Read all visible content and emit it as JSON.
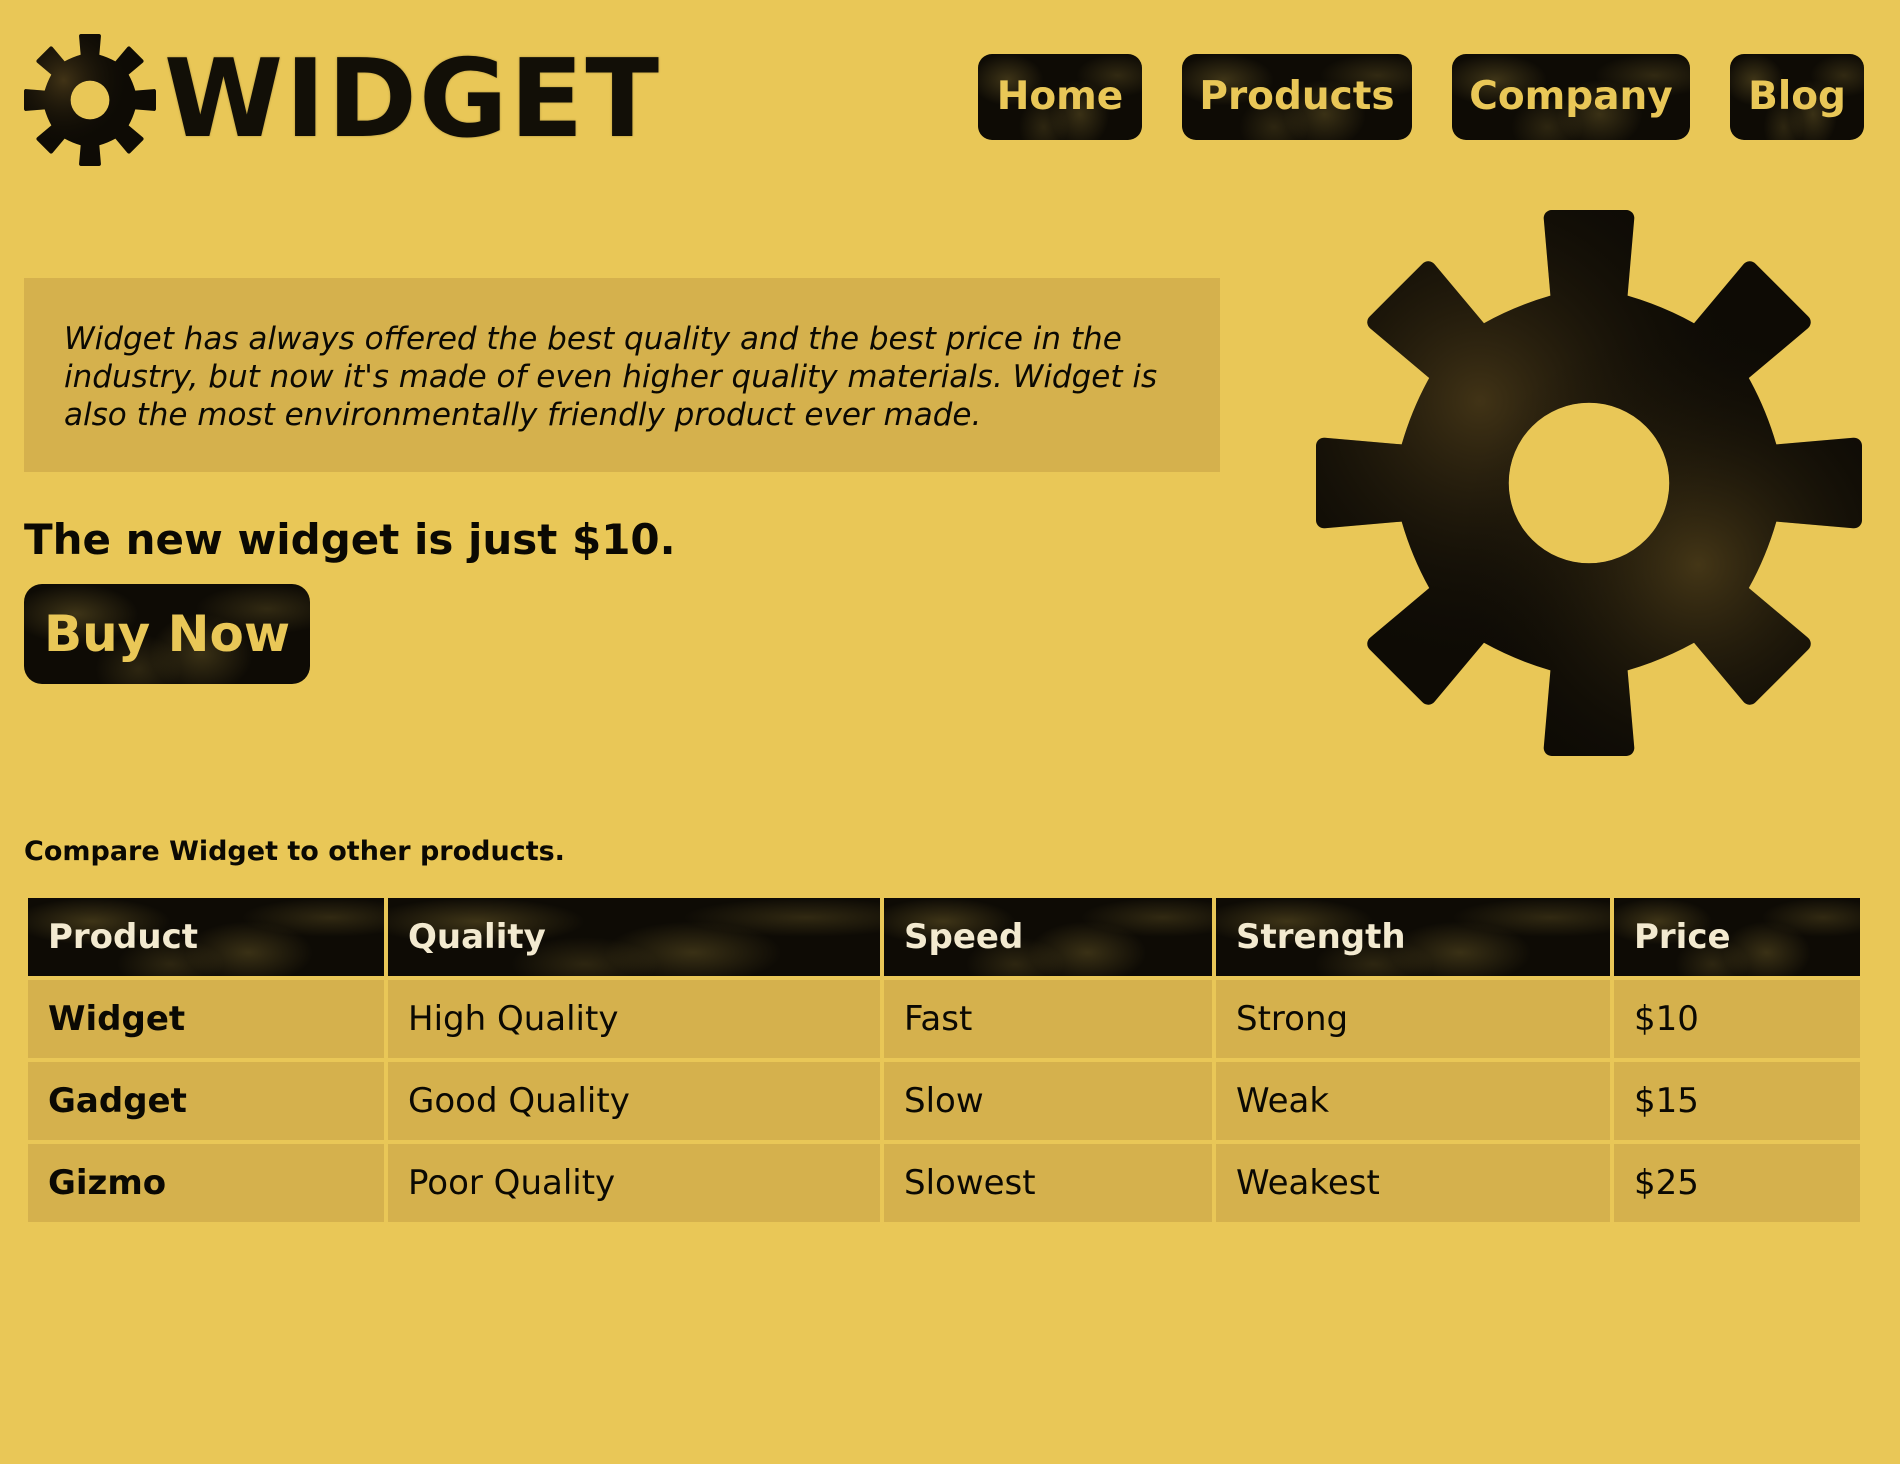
{
  "brand": {
    "name": "WIDGET",
    "logo_icon": "gear-icon"
  },
  "nav": {
    "items": [
      {
        "label": "Home"
      },
      {
        "label": "Products"
      },
      {
        "label": "Company"
      },
      {
        "label": "Blog"
      }
    ]
  },
  "hero": {
    "description": "Widget has always offered the best quality and the best price in the industry, but now it's made of even higher quality materials. Widget is also the most environmentally friendly product ever made.",
    "price_line": "The new widget is just $10.",
    "buy_label": "Buy Now",
    "illustration_icon": "gear-icon"
  },
  "comparison": {
    "caption": "Compare Widget to other products.",
    "headers": [
      "Product",
      "Quality",
      "Speed",
      "Strength",
      "Price"
    ],
    "rows": [
      [
        "Widget",
        "High Quality",
        "Fast",
        "Strong",
        "$10"
      ],
      [
        "Gadget",
        "Good Quality",
        "Slow",
        "Weak",
        "$15"
      ],
      [
        "Gizmo",
        "Poor Quality",
        "Slowest",
        "Weakest",
        "$25"
      ]
    ]
  },
  "colors": {
    "page_background": "#e9c757",
    "panel_background": "#d5b14d",
    "dark": "#0e0b05",
    "button_text": "#e9c757",
    "header_text": "#f3ead0"
  }
}
